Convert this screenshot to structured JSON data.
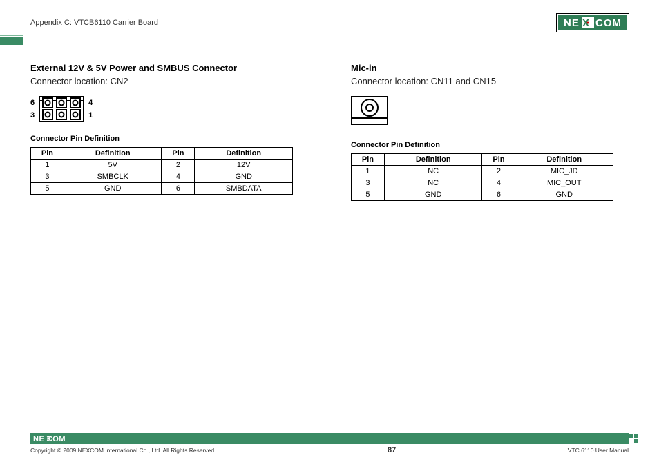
{
  "header": {
    "appendix": "Appendix C: VTCB6110 Carrier Board",
    "logo_text": "NEXCOM"
  },
  "left": {
    "title": "External 12V & 5V Power and SMBUS Connector",
    "location": "Connector location: CN2",
    "pin_labels": {
      "tl": "6",
      "tr": "4",
      "bl": "3",
      "br": "1"
    },
    "table_title": "Connector Pin Definition",
    "headers": [
      "Pin",
      "Definition",
      "Pin",
      "Definition"
    ],
    "rows": [
      [
        "1",
        "5V",
        "2",
        "12V"
      ],
      [
        "3",
        "SMBCLK",
        "4",
        "GND"
      ],
      [
        "5",
        "GND",
        "6",
        "SMBDATA"
      ]
    ]
  },
  "right": {
    "title": "Mic-in",
    "location": "Connector location: CN11 and CN15",
    "table_title": "Connector Pin Definition",
    "headers": [
      "Pin",
      "Definition",
      "Pin",
      "Definition"
    ],
    "rows": [
      [
        "1",
        "NC",
        "2",
        "MIC_JD"
      ],
      [
        "3",
        "NC",
        "4",
        "MIC_OUT"
      ],
      [
        "5",
        "GND",
        "6",
        "GND"
      ]
    ]
  },
  "footer": {
    "copyright": "Copyright © 2009 NEXCOM International Co., Ltd. All Rights Reserved.",
    "page": "87",
    "manual": "VTC 6110 User Manual",
    "logo_text": "NEXCOM"
  },
  "chart_data": [
    {
      "type": "table",
      "title": "External 12V & 5V Power and SMBUS Connector — Connector Pin Definition (CN2)",
      "columns": [
        "Pin",
        "Definition",
        "Pin",
        "Definition"
      ],
      "rows": [
        [
          "1",
          "5V",
          "2",
          "12V"
        ],
        [
          "3",
          "SMBCLK",
          "4",
          "GND"
        ],
        [
          "5",
          "GND",
          "6",
          "SMBDATA"
        ]
      ]
    },
    {
      "type": "table",
      "title": "Mic-in — Connector Pin Definition (CN11 and CN15)",
      "columns": [
        "Pin",
        "Definition",
        "Pin",
        "Definition"
      ],
      "rows": [
        [
          "1",
          "NC",
          "2",
          "MIC_JD"
        ],
        [
          "3",
          "NC",
          "4",
          "MIC_OUT"
        ],
        [
          "5",
          "GND",
          "6",
          "GND"
        ]
      ]
    }
  ]
}
